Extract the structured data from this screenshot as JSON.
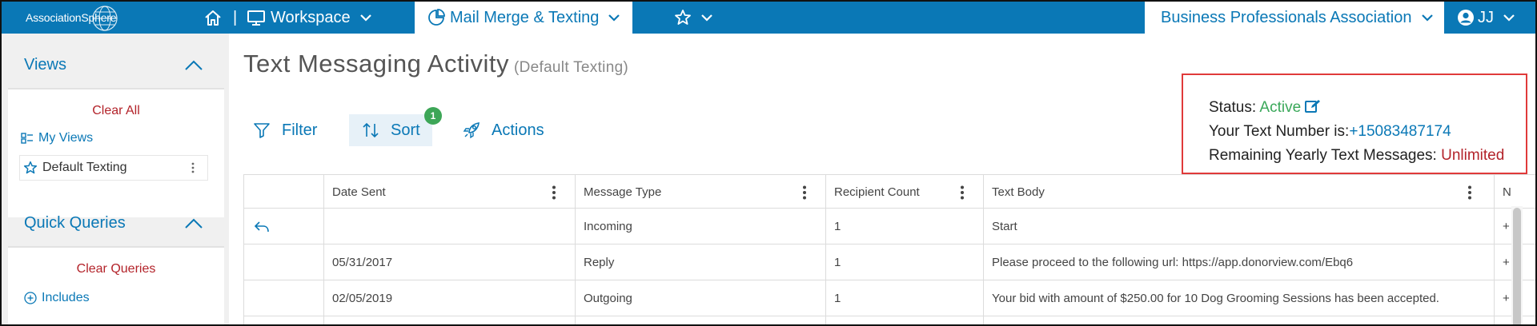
{
  "brand": {
    "logo_text": "AssociationSphere"
  },
  "topnav": {
    "separator": "|",
    "workspace_label": "Workspace",
    "mail_merge_label": "Mail Merge & Texting",
    "org_label": "Business Professionals Association",
    "user_initials": "JJ"
  },
  "sidebar": {
    "views_title": "Views",
    "clear_all": "Clear All",
    "my_views": "My Views",
    "default_texting": "Default Texting",
    "quick_queries_title": "Quick Queries",
    "clear_queries": "Clear Queries",
    "includes": "Includes"
  },
  "page": {
    "title": "Text Messaging Activity",
    "subtitle": "(Default Texting)"
  },
  "toolbar": {
    "filter_label": "Filter",
    "sort_label": "Sort",
    "sort_badge": "1",
    "actions_label": "Actions"
  },
  "status": {
    "status_label": "Status:",
    "status_value": "Active",
    "number_label": "Your Text Number is:",
    "number_value": "+15083487174",
    "remaining_label": "Remaining Yearly Text Messages:",
    "remaining_value": "Unlimited"
  },
  "table": {
    "columns": [
      "Date Sent",
      "Message Type",
      "Recipient Count",
      "Text Body",
      "N"
    ],
    "rows": [
      {
        "date": "",
        "type": "Incoming",
        "count": "1",
        "body": "Start",
        "extra": "+"
      },
      {
        "date": "05/31/2017",
        "type": "Reply",
        "count": "1",
        "body": "Please proceed to the following url: https://app.donorview.com/Ebq6",
        "extra": "+"
      },
      {
        "date": "02/05/2019",
        "type": "Outgoing",
        "count": "1",
        "body": "Your bid with amount of $250.00 for 10 Dog Grooming Sessions has been accepted.",
        "extra": "+"
      }
    ]
  },
  "colors": {
    "brand_blue": "#0a78b6",
    "active_green": "#3aa85a",
    "alert_red": "#b3232a",
    "highlight_border": "#e03a3a"
  },
  "icons": {
    "home": "home-icon",
    "monitor": "monitor-icon",
    "pie": "pie-chart-icon",
    "star": "star-icon",
    "user": "user-circle-icon",
    "filter": "filter-icon",
    "sort": "sort-icon",
    "actions": "rocket-icon",
    "edit": "edit-icon",
    "reply": "reply-icon"
  }
}
